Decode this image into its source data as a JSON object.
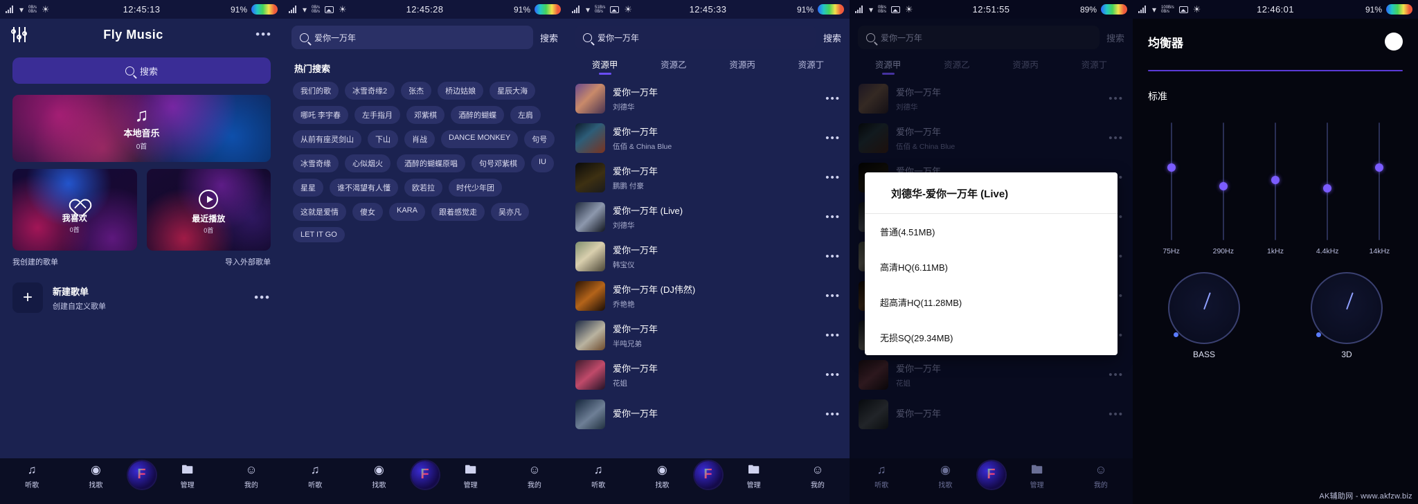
{
  "statusbars": [
    {
      "time": "12:45:13",
      "battery": "91%",
      "net_up": "0B/s",
      "net_down": "0B/s"
    },
    {
      "time": "12:45:28",
      "battery": "91%",
      "net_up": "0B/s",
      "net_down": "0B/s"
    },
    {
      "time": "12:45:33",
      "battery": "91%",
      "net_up": "51B/s",
      "net_down": "0B/s"
    },
    {
      "time": "12:51:55",
      "battery": "89%",
      "net_up": "0B/s",
      "net_down": "0B/s"
    },
    {
      "time": "12:46:01",
      "battery": "91%",
      "net_up": "100B/s",
      "net_down": "0B/s"
    }
  ],
  "home": {
    "title": "Fly Music",
    "more_label": "•••",
    "search_placeholder": "搜索",
    "local_music": {
      "name": "本地音乐",
      "count": "0首",
      "icon": "music-note-icon"
    },
    "favorites": {
      "name": "我喜欢",
      "count": "0首",
      "icon": "heart-pulse-icon"
    },
    "recent": {
      "name": "最近播放",
      "count": "0首",
      "icon": "play-circle-icon"
    },
    "created_label": "我创建的歌单",
    "import_label": "导入外部歌单",
    "new_playlist": {
      "title": "新建歌单",
      "subtitle": "创建自定义歌单",
      "icon": "plus-icon",
      "more": "•••"
    }
  },
  "nav": {
    "items": [
      {
        "label": "听歌",
        "icon": "music-note-icon"
      },
      {
        "label": "找歌",
        "icon": "planet-icon"
      },
      {
        "label": "管理",
        "icon": "folder-icon"
      },
      {
        "label": "我的",
        "icon": "person-icon"
      }
    ],
    "logo": "F"
  },
  "search": {
    "query": "爱你一万年",
    "button_label": "搜索",
    "hot_title": "热门搜索",
    "hot_tags": [
      "我们的歌",
      "冰雪奇缘2",
      "张杰",
      "桥边姑娘",
      "星辰大海",
      "哪吒 李宇春",
      "左手指月",
      "邓紫棋",
      "酒醉的蝴蝶",
      "左肩",
      "从前有座灵剑山",
      "下山",
      "肖战",
      "DANCE MONKEY",
      "句号",
      "冰雪奇缘",
      "心似烟火",
      "酒醉的蝴蝶原唱",
      "句号邓紫棋",
      "IU",
      "星星",
      "谁不渴望有人懂",
      "欧若拉",
      "时代少年团",
      "这就是爱情",
      "傻女",
      "KARA",
      "跟着感觉走",
      "吴亦凡",
      "LET IT GO"
    ]
  },
  "tabs": {
    "items": [
      "资源甲",
      "资源乙",
      "资源丙",
      "资源丁"
    ],
    "active_index": 0
  },
  "songs": [
    {
      "title": "爱你一万年",
      "artist": "刘德华",
      "cover": "cv1",
      "more": "•••"
    },
    {
      "title": "爱你一万年",
      "artist": "伍佰 & China Blue",
      "cover": "cv2",
      "more": "•••"
    },
    {
      "title": "爱你一万年",
      "artist": "鹏鹏 付豪",
      "cover": "cv3",
      "more": "•••"
    },
    {
      "title": "爱你一万年 (Live)",
      "artist": "刘德华",
      "cover": "cv4",
      "more": "•••"
    },
    {
      "title": "爱你一万年",
      "artist": "韩宝仪",
      "cover": "cv5",
      "more": "•••"
    },
    {
      "title": "爱你一万年 (DJ伟然)",
      "artist": "乔艳艳",
      "cover": "cv6",
      "more": "•••"
    },
    {
      "title": "爱你一万年",
      "artist": "半吨兄弟",
      "cover": "cv7",
      "more": "•••"
    },
    {
      "title": "爱你一万年",
      "artist": "花姐",
      "cover": "cv8",
      "more": "•••"
    },
    {
      "title": "爱你一万年",
      "artist": "",
      "cover": "cv9",
      "more": "•••"
    }
  ],
  "quality_dialog": {
    "title": "刘德华-爱你一万年 (Live)",
    "options": [
      "普通(4.51MB)",
      "高清HQ(6.11MB)",
      "超高清HQ(11.28MB)",
      "无损SQ(29.34MB)"
    ]
  },
  "equalizer": {
    "title": "均衡器",
    "toggle_state": "on",
    "preset_label": "标准",
    "bands": [
      {
        "freq": "75Hz",
        "value": 62
      },
      {
        "freq": "290Hz",
        "value": 46
      },
      {
        "freq": "1kHz",
        "value": 51
      },
      {
        "freq": "4.4kHz",
        "value": 44
      },
      {
        "freq": "14kHz",
        "value": 62
      }
    ],
    "knobs": [
      {
        "label": "BASS"
      },
      {
        "label": "3D"
      }
    ]
  },
  "watermark": "AK辅助网 - www.akfzw.biz"
}
